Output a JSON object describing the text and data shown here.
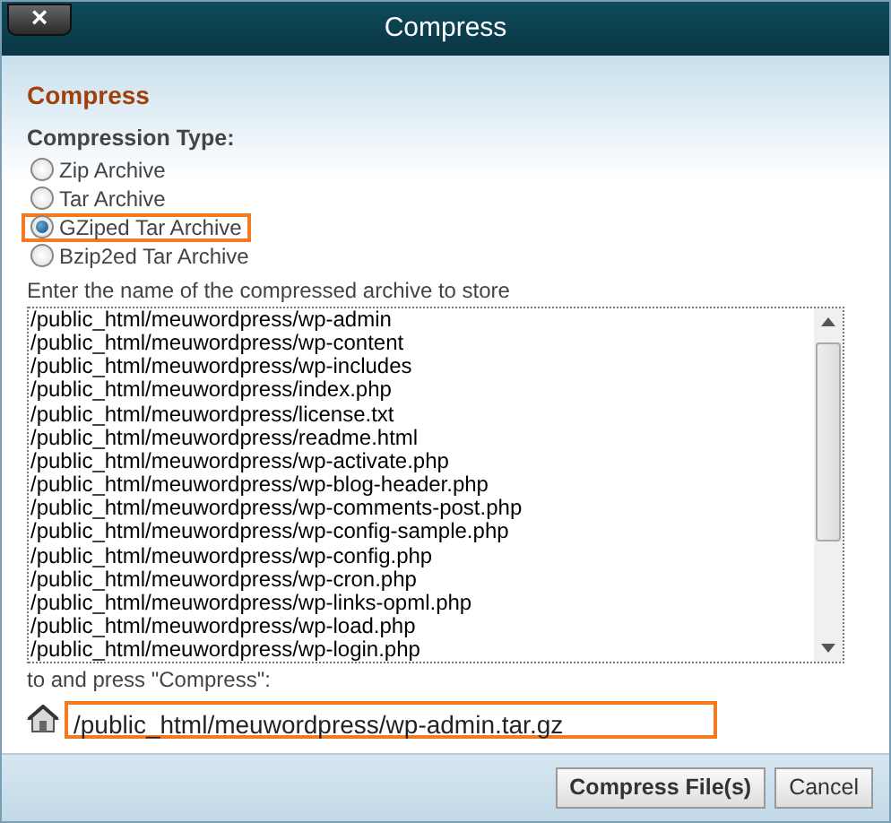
{
  "window": {
    "title": "Compress",
    "close_label": "×"
  },
  "heading": "Compress",
  "type_label": "Compression Type:",
  "options": [
    {
      "label": "Zip Archive",
      "selected": false,
      "highlighted": false
    },
    {
      "label": "Tar Archive",
      "selected": false,
      "highlighted": false
    },
    {
      "label": "GZiped Tar Archive",
      "selected": true,
      "highlighted": true
    },
    {
      "label": "Bzip2ed Tar Archive",
      "selected": false,
      "highlighted": false
    }
  ],
  "prompt_before": "Enter the name of the compressed archive to store",
  "files": [
    "/public_html/meuwordpress/wp-admin",
    "/public_html/meuwordpress/wp-content",
    "/public_html/meuwordpress/wp-includes",
    "/public_html/meuwordpress/index.php",
    "/public_html/meuwordpress/license.txt",
    "/public_html/meuwordpress/readme.html",
    "/public_html/meuwordpress/wp-activate.php",
    "/public_html/meuwordpress/wp-blog-header.php",
    "/public_html/meuwordpress/wp-comments-post.php",
    "/public_html/meuwordpress/wp-config-sample.php",
    "/public_html/meuwordpress/wp-config.php",
    "/public_html/meuwordpress/wp-cron.php",
    "/public_html/meuwordpress/wp-links-opml.php",
    "/public_html/meuwordpress/wp-load.php",
    "/public_html/meuwordpress/wp-login.php"
  ],
  "prompt_after": "to and press \"Compress\":",
  "archive_field": {
    "value": "/public_html/meuwordpress/wp-admin.tar.gz",
    "highlighted": true
  },
  "buttons": [
    "Compress File(s)",
    "Cancel"
  ]
}
